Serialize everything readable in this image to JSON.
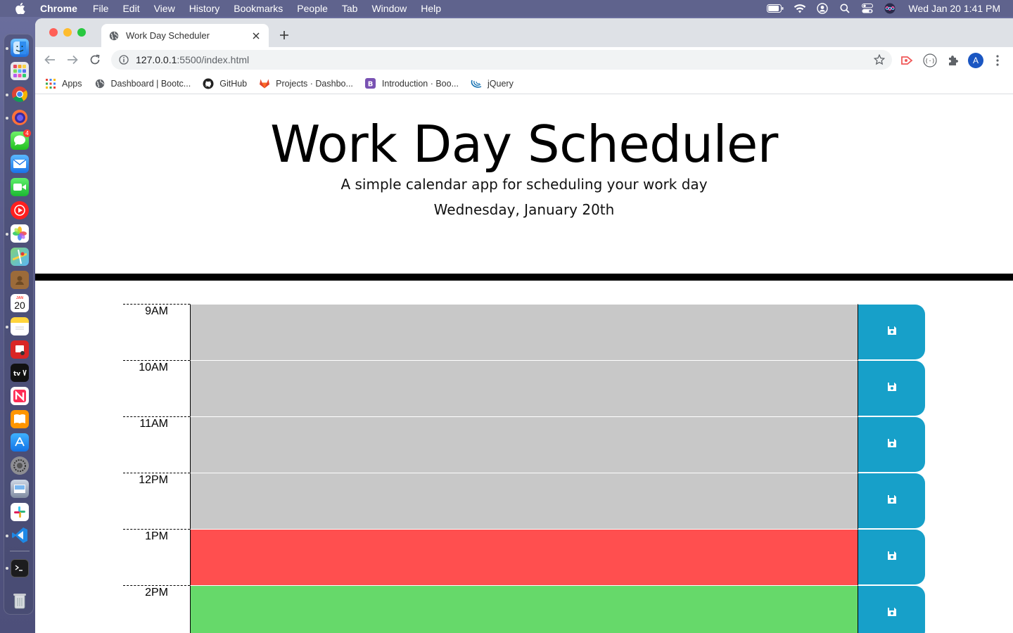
{
  "menubar": {
    "app_name": "Chrome",
    "items": [
      "File",
      "Edit",
      "View",
      "History",
      "Bookmarks",
      "People",
      "Tab",
      "Window",
      "Help"
    ],
    "clock": "Wed Jan 20  1:41 PM"
  },
  "dock": {
    "calendar_day": "20",
    "calendar_month": "JAN",
    "messages_badge": "4"
  },
  "browser": {
    "tab_title": "Work Day Scheduler",
    "url_host": "127.0.0.1",
    "url_path": ":5500/index.html",
    "profile_initial": "A",
    "bookmarks": [
      {
        "label": "Apps",
        "icon": "apps-grid-icon"
      },
      {
        "label": "Dashboard | Bootc...",
        "icon": "globe-icon"
      },
      {
        "label": "GitHub",
        "icon": "github-icon"
      },
      {
        "label": "Projects · Dashbo...",
        "icon": "gitlab-icon"
      },
      {
        "label": "Introduction · Boo...",
        "icon": "bootstrap-icon"
      },
      {
        "label": "jQuery",
        "icon": "jquery-icon"
      }
    ]
  },
  "page": {
    "title": "Work Day Scheduler",
    "lead": "A simple calendar app for scheduling your work day",
    "current_day": "Wednesday, January 20th",
    "rows": [
      {
        "hour": "9AM",
        "state": "past",
        "text": ""
      },
      {
        "hour": "10AM",
        "state": "past",
        "text": ""
      },
      {
        "hour": "11AM",
        "state": "past",
        "text": ""
      },
      {
        "hour": "12PM",
        "state": "past",
        "text": ""
      },
      {
        "hour": "1PM",
        "state": "present",
        "text": ""
      },
      {
        "hour": "2PM",
        "state": "future",
        "text": ""
      }
    ],
    "colors": {
      "past": "#c8c8c8",
      "present": "#ff4f4f",
      "future": "#66d96a",
      "save_button": "#17a0c9"
    },
    "save_icon": "floppy-disk-icon"
  }
}
